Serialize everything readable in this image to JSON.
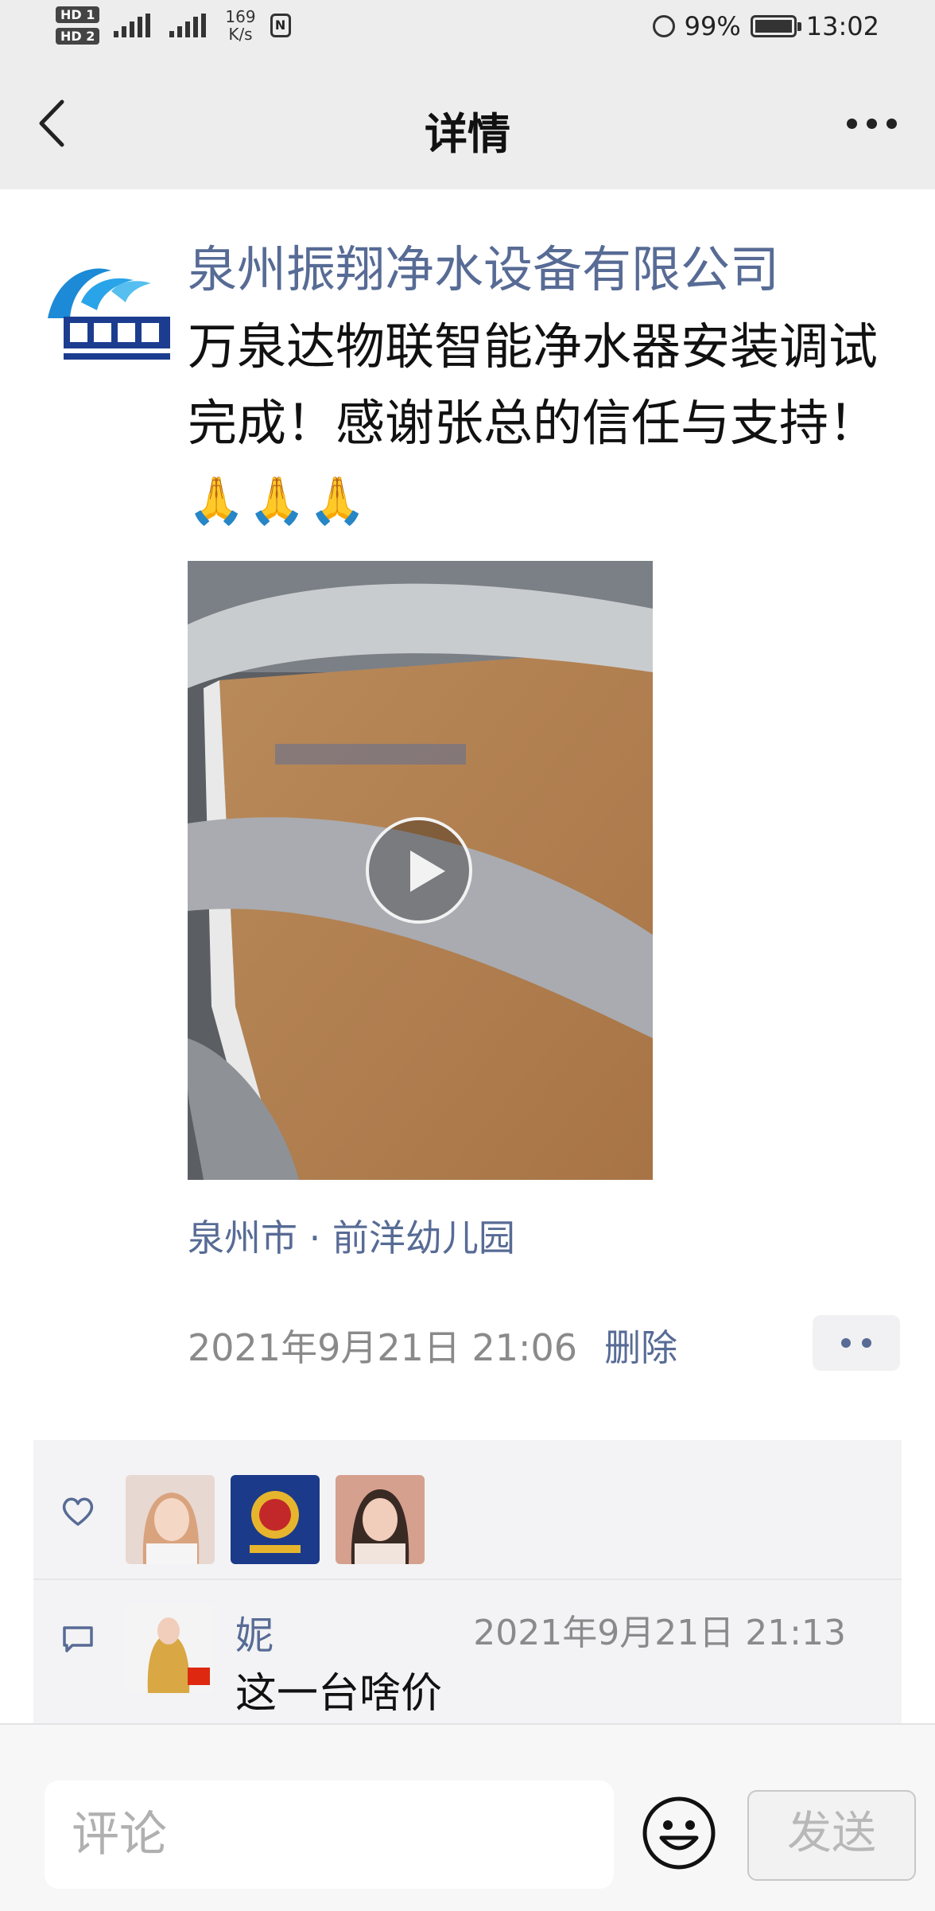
{
  "status_bar": {
    "sim1": "HD 1",
    "sim2": "HD 2",
    "network_speed": "169",
    "network_unit": "K/s",
    "battery": "99%",
    "time": "13:02"
  },
  "nav": {
    "title": "详情"
  },
  "post": {
    "author": "泉州振翔净水设备有限公司",
    "text": "万泉达物联智能净水器安装调试完成！感谢张总的信任与支持！",
    "emoji": "🙏🙏🙏",
    "location": "泉州市 · 前洋幼儿园",
    "timestamp": "2021年9月21日 21:06",
    "delete_label": "删除"
  },
  "comments": [
    {
      "name": "妮",
      "time": "2021年9月21日 21:13",
      "text": "这一台啥价"
    }
  ],
  "comment_bar": {
    "placeholder": "评论",
    "send_label": "发送"
  },
  "colors": {
    "link_blue": "#576b95",
    "top_bg": "#ededed",
    "panel_bg": "#f3f3f5"
  }
}
